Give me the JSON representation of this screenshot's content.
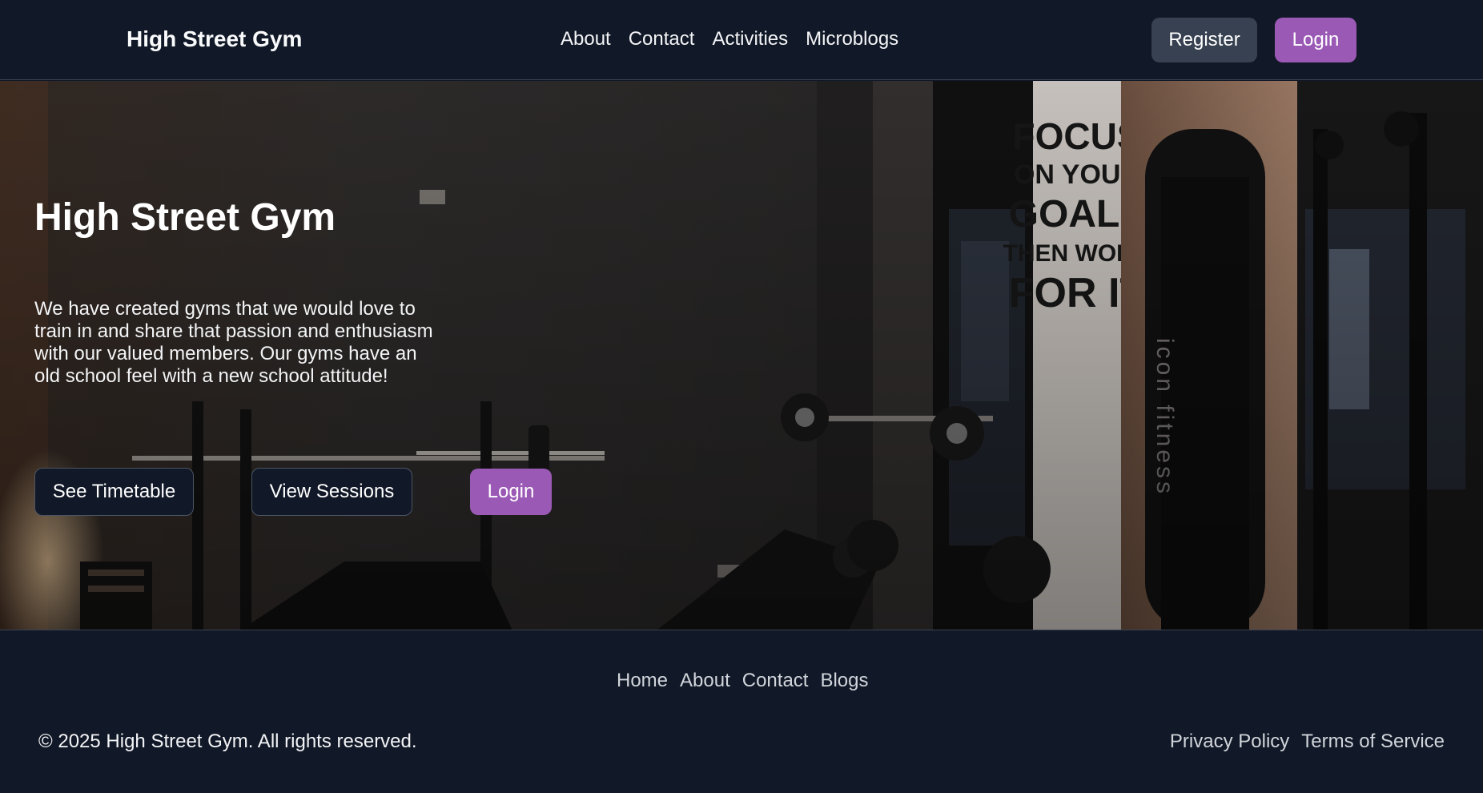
{
  "navbar": {
    "brand": "High Street Gym",
    "links": [
      "About",
      "Contact",
      "Activities",
      "Microblogs"
    ],
    "register_label": "Register",
    "login_label": "Login"
  },
  "hero": {
    "title": "High Street Gym",
    "description": "We have created gyms that we would love to train in and share that passion and enthusiasm with our valued members. Our gyms have an old school feel with a new school attitude!",
    "buttons": {
      "timetable": "See Timetable",
      "sessions": "View Sessions",
      "login": "Login"
    },
    "background_image": {
      "sign_lines": [
        "FOCUS",
        "ON YOUR",
        "GOALS",
        "THEN WORK",
        "FOR IT"
      ],
      "machine_brand": "icon fitness"
    }
  },
  "footer": {
    "links": [
      "Home",
      "About",
      "Contact",
      "Blogs"
    ],
    "copyright": "© 2025 High Street Gym. All rights reserved.",
    "legal_links": [
      "Privacy Policy",
      "Terms of Service"
    ]
  },
  "colors": {
    "background": "#111827",
    "accent_purple": "#9b59b6",
    "button_gray": "#374151"
  }
}
